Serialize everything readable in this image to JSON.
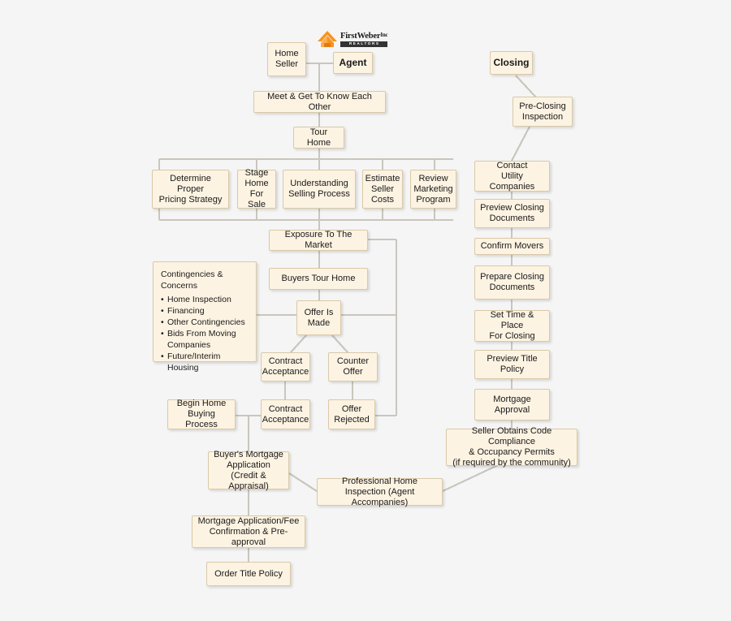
{
  "meta": {
    "title": "Home Selling & Buying Process Flowchart",
    "background_color": "#f5f5f5",
    "box_fill_color": "#fdf3e2",
    "box_border_color": "#d9c9a8",
    "line_color": "#c9c6bd"
  },
  "logo": {
    "name": "firstweber-realtors-logo",
    "word_first": "First",
    "word_weber": "Weber",
    "word_sup": "Inc",
    "tagline": "REALTORS",
    "house_color": "#f7941e",
    "house_color_dark": "#e07b12"
  },
  "nodes": {
    "home_seller": "Home\nSeller",
    "agent": "Agent",
    "closing": "Closing",
    "meet_get_to_know": "Meet & Get To Know Each Other",
    "tour_home": "Tour Home",
    "determine_pricing": "Determine Proper\nPricing Strategy",
    "stage_home": "Stage\nHome\nFor Sale",
    "understanding_selling": "Understanding\nSelling Process",
    "estimate_costs": "Estimate\nSeller\nCosts",
    "review_marketing": "Review\nMarketing\nProgram",
    "exposure_market": "Exposure To The Market",
    "buyers_tour_home": "Buyers Tour Home",
    "offer_is_made": "Offer Is\nMade",
    "contract_acceptance_1": "Contract\nAcceptance",
    "counter_offer": "Counter\nOffer",
    "contract_acceptance_2": "Contract\nAcceptance",
    "offer_rejected": "Offer\nRejected",
    "begin_home_buying": "Begin Home\nBuying Process",
    "buyers_mortgage_application": "Buyer's Mortgage\nApplication\n(Credit & Appraisal)",
    "professional_home_inspection": "Professional Home\nInspection (Agent Accompanies)",
    "mortgage_app_fee": "Mortgage Application/Fee\nConfirmation & Pre-approval",
    "order_title_policy": "Order Title Policy",
    "pre_closing_inspection": "Pre-Closing\nInspection",
    "contact_utility": "Contact\nUtility Companies",
    "preview_closing_docs": "Preview Closing\nDocuments",
    "confirm_movers": "Confirm Movers",
    "prepare_closing_docs": "Prepare Closing\nDocuments",
    "set_time_place": "Set Time & Place\nFor Closing",
    "preview_title_policy": "Preview Title\nPolicy",
    "mortgage_approval": "Mortgage\nApproval",
    "seller_code_compliance": "Seller Obtains Code Compliance\n& Occupancy Permits\n(if required by the community)"
  },
  "contingencies": {
    "title": "Contingencies & Concerns",
    "items": [
      "Home Inspection",
      "Financing",
      "Other Contingencies",
      "Bids From Moving\nCompanies",
      "Future/Interim Housing"
    ]
  }
}
